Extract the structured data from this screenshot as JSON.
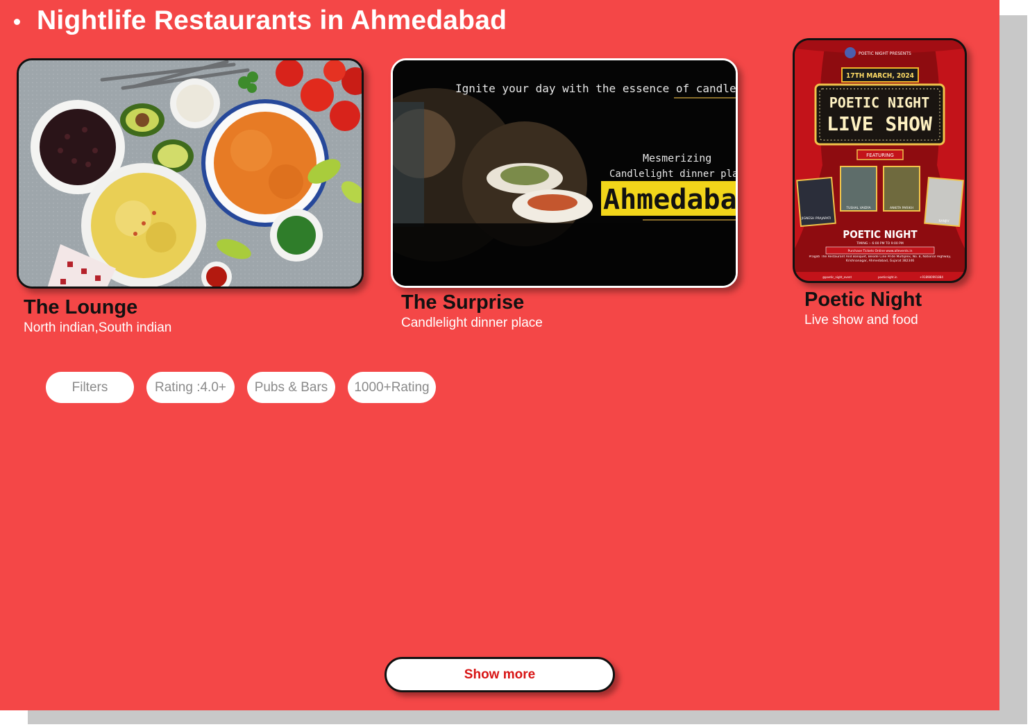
{
  "page": {
    "heading": "Nightlife Restaurants in Ahmedabad"
  },
  "cards": [
    {
      "title": "The Lounge",
      "subtitle": "North indian,South indian",
      "image_alt": "Mexican food spread with rice, beans, corn, avocado and tomatoes"
    },
    {
      "title": "The Surprise",
      "subtitle": "Candlelight dinner place",
      "image_text": {
        "line1": "Ignite your day with the essence of candlelight dinne",
        "line2": "Mesmerizing",
        "line3": "Candlelight dinner places",
        "city": "Ahmedaba"
      }
    },
    {
      "title": "Poetic Night",
      "subtitle": "Live show and food",
      "poster_text": {
        "presents": "POETIC NIGHT PRESENTS",
        "date": "17TH MARCH, 2024",
        "headline1": "POETIC NIGHT",
        "headline2": "LIVE SHOW",
        "featuring": "FEATURING",
        "names": [
          "JIGNESH PRAJAPATI",
          "TUSHAL VAIDYA",
          "ANKITA PARIKH",
          "RANJIV"
        ],
        "footer_title": "POETIC NIGHT",
        "timing": "TIMING :- 6:00 PM TO 9:00 PM",
        "tickets": "Purchase Tickets Online www.allevents.in",
        "venue": "Pragati The Restaurant And Banquet, Beside Cine Pride Multiplex, No. 8, National Highway, Krishnanagar, Ahmedabad, Gujarat 382346",
        "social1": "@poetic_night_event",
        "social2": "poeticnight.in",
        "phone": "+918980991884"
      }
    }
  ],
  "filters": {
    "items": [
      "Filters",
      "Rating :4.0+",
      "Pubs & Bars",
      "1000+Rating"
    ]
  },
  "actions": {
    "show_more": "Show more"
  },
  "colors": {
    "background": "#f44747",
    "chip_text": "#8a8a8a",
    "button_text": "#d81414"
  }
}
